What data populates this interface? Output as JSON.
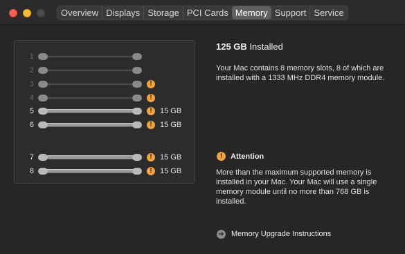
{
  "tabs": [
    "Overview",
    "Displays",
    "Storage",
    "PCI Cards",
    "Memory",
    "Support",
    "Service"
  ],
  "active_tab": "Memory",
  "slots": [
    {
      "num": "1",
      "filled": false,
      "warn": false,
      "size": ""
    },
    {
      "num": "2",
      "filled": false,
      "warn": false,
      "size": ""
    },
    {
      "num": "3",
      "filled": false,
      "warn": true,
      "size": ""
    },
    {
      "num": "4",
      "filled": false,
      "warn": true,
      "size": ""
    },
    {
      "num": "5",
      "filled": true,
      "warn": true,
      "size": "15 GB"
    },
    {
      "num": "6",
      "filled": true,
      "warn": true,
      "size": "15 GB"
    },
    {
      "num": "7",
      "filled": true,
      "warn": true,
      "size": "15 GB"
    },
    {
      "num": "8",
      "filled": true,
      "warn": true,
      "size": "15 GB"
    }
  ],
  "summary": {
    "amount": "125 GB",
    "installed_label": "Installed",
    "description": "Your Mac contains 8 memory slots, 8 of which are installed with a 1333 MHz DDR4 memory module."
  },
  "attention": {
    "icon": "!",
    "title": "Attention",
    "text": "More than the maximum supported memory is installed in your Mac. Your Mac will use a single memory module until no more than 768 GB is installed."
  },
  "upgrade": {
    "icon": "➔",
    "label": "Memory Upgrade Instructions"
  },
  "colors": {
    "warning": "#f2a33a",
    "background": "#262627"
  }
}
